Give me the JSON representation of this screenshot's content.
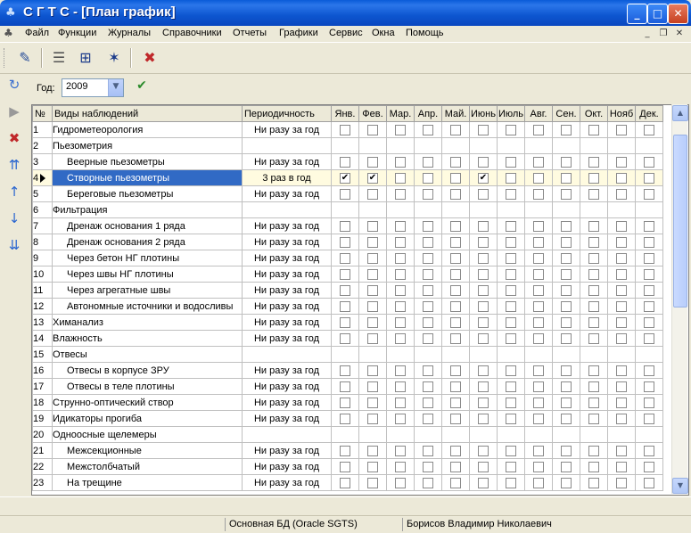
{
  "window": {
    "title": "С Г Т С - [План график]"
  },
  "menu": [
    "Файл",
    "Функции",
    "Журналы",
    "Справочники",
    "Отчеты",
    "Графики",
    "Сервис",
    "Окна",
    "Помощь"
  ],
  "toolbar": {
    "icons": [
      "report-edit-icon",
      "list-icon",
      "grid-point-icon",
      "plot-icon",
      "delete-table-icon"
    ]
  },
  "filter": {
    "year_label": "Год:",
    "year_value": "2009"
  },
  "left_tools": [
    "refresh-icon",
    "next-icon",
    "delete-row-icon",
    "move-top-icon",
    "move-up-icon",
    "move-down-icon",
    "move-bottom-icon"
  ],
  "grid": {
    "headers": {
      "num": "№",
      "name": "Виды наблюдений",
      "period": "Периодичность",
      "months": [
        "Янв.",
        "Фев.",
        "Мар.",
        "Апр.",
        "Май.",
        "Июнь",
        "Июль",
        "Авг.",
        "Сен.",
        "Окт.",
        "Нояб",
        "Дек."
      ]
    },
    "rows": [
      {
        "num": "1",
        "name": "Гидрометеорология",
        "period": "Ни разу за год",
        "indent": false,
        "has_checks": true,
        "checked": []
      },
      {
        "num": "2",
        "name": "Пьезометрия",
        "period": "",
        "indent": false,
        "has_checks": false,
        "checked": []
      },
      {
        "num": "3",
        "name": "Веерные пьезометры",
        "period": "Ни разу за год",
        "indent": true,
        "has_checks": true,
        "checked": []
      },
      {
        "num": "4",
        "name": "Створные пьезометры",
        "period": "3 раз в год",
        "indent": true,
        "has_checks": true,
        "checked": [
          0,
          1,
          5
        ],
        "selected": true
      },
      {
        "num": "5",
        "name": "Береговые пьезометры",
        "period": "Ни разу за год",
        "indent": true,
        "has_checks": true,
        "checked": []
      },
      {
        "num": "6",
        "name": "Фильтрация",
        "period": "",
        "indent": false,
        "has_checks": false,
        "checked": []
      },
      {
        "num": "7",
        "name": "Дренаж основания 1 ряда",
        "period": "Ни разу за год",
        "indent": true,
        "has_checks": true,
        "checked": []
      },
      {
        "num": "8",
        "name": "Дренаж основания 2 ряда",
        "period": "Ни разу за год",
        "indent": true,
        "has_checks": true,
        "checked": []
      },
      {
        "num": "9",
        "name": "Через бетон НГ плотины",
        "period": "Ни разу за год",
        "indent": true,
        "has_checks": true,
        "checked": []
      },
      {
        "num": "10",
        "name": "Через швы НГ плотины",
        "period": "Ни разу за год",
        "indent": true,
        "has_checks": true,
        "checked": []
      },
      {
        "num": "11",
        "name": "Через агрегатные швы",
        "period": "Ни разу за год",
        "indent": true,
        "has_checks": true,
        "checked": []
      },
      {
        "num": "12",
        "name": "Автономные источники и водосливы",
        "period": "Ни разу за год",
        "indent": true,
        "has_checks": true,
        "checked": []
      },
      {
        "num": "13",
        "name": "Химанализ",
        "period": "Ни разу за год",
        "indent": false,
        "has_checks": true,
        "checked": []
      },
      {
        "num": "14",
        "name": "Влажность",
        "period": "Ни разу за год",
        "indent": false,
        "has_checks": true,
        "checked": []
      },
      {
        "num": "15",
        "name": "Отвесы",
        "period": "",
        "indent": false,
        "has_checks": false,
        "checked": []
      },
      {
        "num": "16",
        "name": "Отвесы в корпусе ЗРУ",
        "period": "Ни разу за год",
        "indent": true,
        "has_checks": true,
        "checked": []
      },
      {
        "num": "17",
        "name": "Отвесы в теле плотины",
        "period": "Ни разу за год",
        "indent": true,
        "has_checks": true,
        "checked": []
      },
      {
        "num": "18",
        "name": "Струнно-оптический створ",
        "period": "Ни разу за год",
        "indent": false,
        "has_checks": true,
        "checked": []
      },
      {
        "num": "19",
        "name": "Идикаторы прогиба",
        "period": "Ни разу за год",
        "indent": false,
        "has_checks": true,
        "checked": []
      },
      {
        "num": "20",
        "name": "Одноосные щелемеры",
        "period": "",
        "indent": false,
        "has_checks": false,
        "checked": []
      },
      {
        "num": "21",
        "name": "Межсекционные",
        "period": "Ни разу за год",
        "indent": true,
        "has_checks": true,
        "checked": []
      },
      {
        "num": "22",
        "name": "Межстолбчатый",
        "period": "Ни разу за год",
        "indent": true,
        "has_checks": true,
        "checked": []
      },
      {
        "num": "23",
        "name": "На трещине",
        "period": "Ни разу за год",
        "indent": true,
        "has_checks": true,
        "checked": []
      }
    ]
  },
  "status": {
    "db": "Основная БД (Oracle SGTS)",
    "user": "Борисов Владимир Николаевич"
  },
  "colors": {
    "title_blue": "#0a5bd8",
    "selection": "#316ac5",
    "selected_row_bg": "#fffbe0"
  }
}
